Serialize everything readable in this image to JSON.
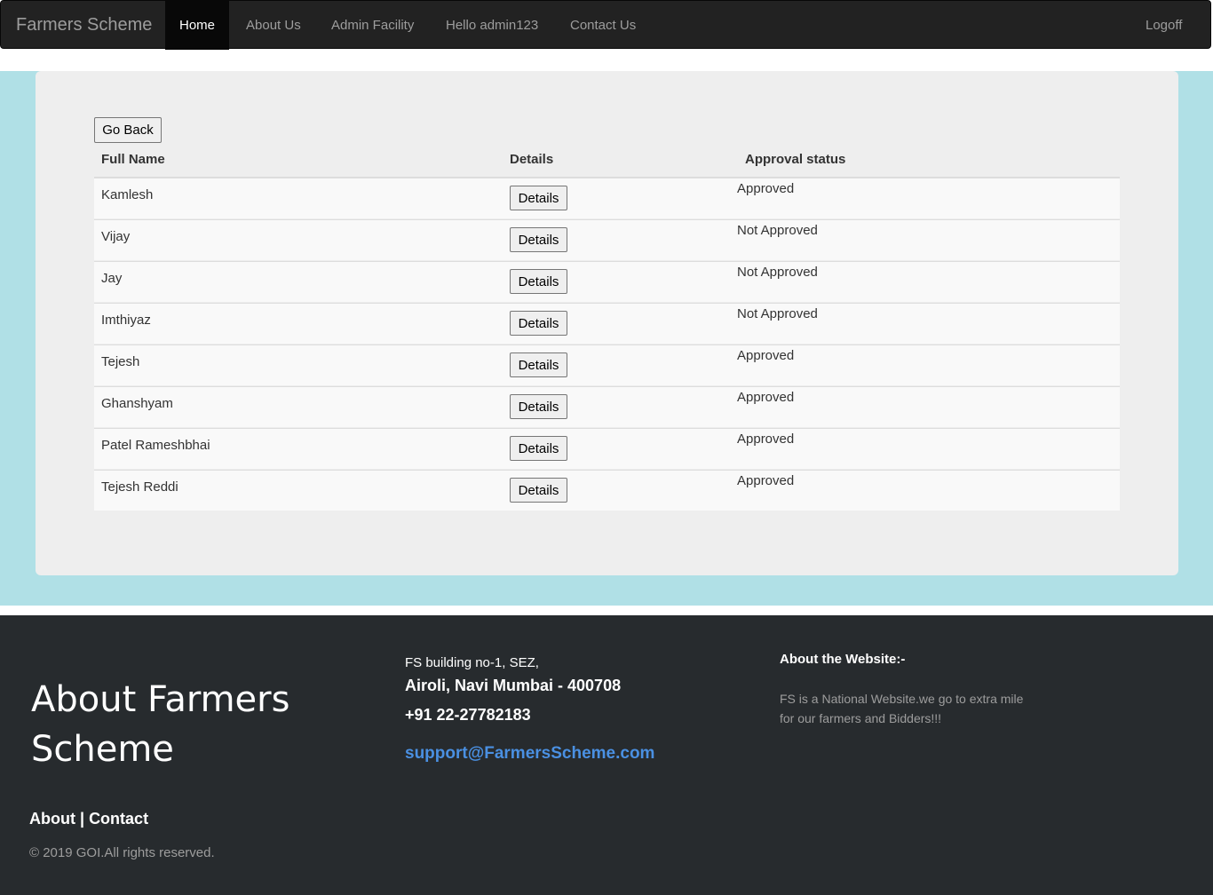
{
  "navbar": {
    "brand": "Farmers Scheme",
    "items": [
      {
        "label": "Home",
        "active": true
      },
      {
        "label": "About Us"
      },
      {
        "label": "Admin Facility"
      },
      {
        "label": "Hello admin123"
      },
      {
        "label": "Contact Us"
      }
    ],
    "logoff": "Logoff"
  },
  "main": {
    "go_back_label": "Go Back",
    "table": {
      "headers": [
        "Full Name",
        "Details",
        "Approval status"
      ],
      "rows": [
        {
          "name": "Kamlesh",
          "button": "Details",
          "status": "Approved"
        },
        {
          "name": "Vijay",
          "button": "Details",
          "status": "Not Approved"
        },
        {
          "name": "Jay",
          "button": "Details",
          "status": "Not Approved"
        },
        {
          "name": "Imthiyaz",
          "button": "Details",
          "status": "Not Approved"
        },
        {
          "name": "Tejesh",
          "button": "Details",
          "status": "Approved"
        },
        {
          "name": "Ghanshyam",
          "button": "Details",
          "status": "Approved"
        },
        {
          "name": "Patel Rameshbhai",
          "button": "Details",
          "status": "Approved"
        },
        {
          "name": "Tejesh Reddi",
          "button": "Details",
          "status": "Approved"
        }
      ]
    }
  },
  "footer": {
    "title": "About Farmers Scheme",
    "links": {
      "about": "About",
      "separator": "|",
      "contact": "Contact"
    },
    "copyright": "© 2019 GOI.All rights reserved.",
    "address_line1": "FS building no-1, SEZ,",
    "address_line2": "Airoli, Navi Mumbai - 400708",
    "phone": "+91 22-27782183",
    "email": "support@FarmersScheme.com",
    "about_heading": "About the Website:-",
    "about_text": "FS is a National Website.we go to extra mile for our farmers and Bidders!!!"
  },
  "colors": {
    "navbar_bg": "#222222",
    "band_bg": "#b0e0e6",
    "card_bg": "#eeeeee",
    "footer_bg": "#272b2e",
    "email_link": "#4a90e2"
  }
}
